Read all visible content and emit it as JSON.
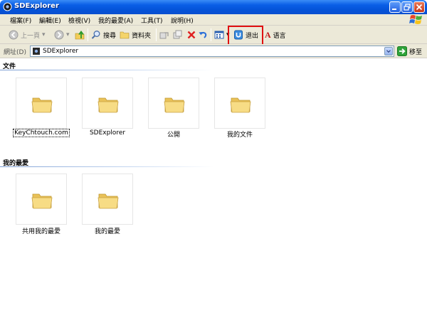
{
  "window": {
    "title": "SDExplorer"
  },
  "menu": {
    "items": [
      "檔案(F)",
      "編輯(E)",
      "檢視(V)",
      "我的最愛(A)",
      "工具(T)",
      "說明(H)"
    ]
  },
  "toolbar": {
    "back_label": "上一頁",
    "search_label": "搜尋",
    "folders_label": "資料夾",
    "exit_label": "退出",
    "language_label": "语言"
  },
  "address": {
    "label": "網址(D)",
    "value": "SDExplorer",
    "go_label": "移至"
  },
  "groups": [
    {
      "header": "文件",
      "items": [
        "KeyChtouch.com",
        "SDExplorer",
        "公開",
        "我的文件"
      ]
    },
    {
      "header": "我的最愛",
      "items": [
        "共用我的最愛",
        "我的最愛"
      ]
    }
  ],
  "colors": {
    "titlebar": "#0453d8",
    "chrome": "#ece9d8",
    "highlight": "#e01010",
    "folder": "#f5d77a"
  }
}
